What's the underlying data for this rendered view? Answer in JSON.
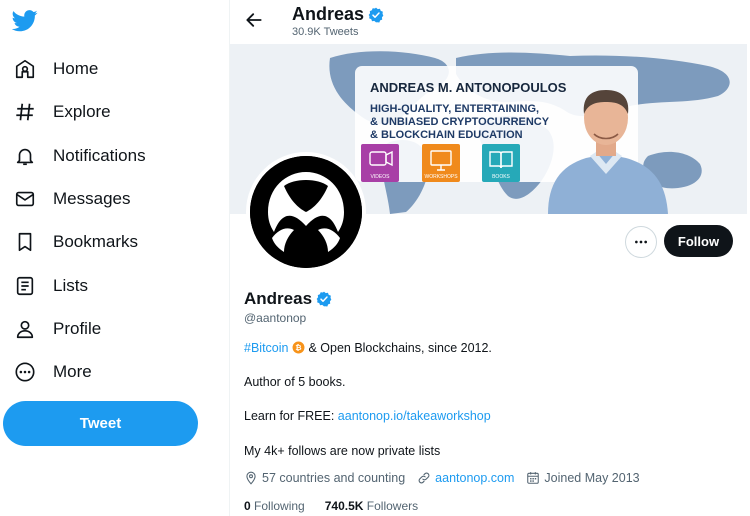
{
  "sidebar": {
    "items": [
      {
        "label": "Home",
        "icon": "home-icon"
      },
      {
        "label": "Explore",
        "icon": "hashtag-icon"
      },
      {
        "label": "Notifications",
        "icon": "bell-icon"
      },
      {
        "label": "Messages",
        "icon": "envelope-icon"
      },
      {
        "label": "Bookmarks",
        "icon": "bookmark-icon"
      },
      {
        "label": "Lists",
        "icon": "list-icon"
      },
      {
        "label": "Profile",
        "icon": "person-icon"
      },
      {
        "label": "More",
        "icon": "more-circle-icon"
      }
    ],
    "tweet_label": "Tweet"
  },
  "header": {
    "name": "Andreas",
    "tweet_count": "30.9K Tweets"
  },
  "banner": {
    "title": "ANDREAS M. ANTONOPOULOS",
    "tagline1": "HIGH-QUALITY, ENTERTAINING,",
    "tagline2": "& UNBIASED CRYPTOCURRENCY",
    "tagline3": "& BLOCKCHAIN EDUCATION",
    "tiles": [
      "VIDEOS",
      "WORKSHOPS",
      "BOOKS"
    ]
  },
  "profile": {
    "follow_label": "Follow",
    "name": "Andreas",
    "handle": "@aantonop",
    "bio_hashtag": "#Bitcoin",
    "bio_line1_rest": " & Open Blockchains, since 2012.",
    "bio_line2": "Author of 5 books.",
    "bio_line3_prefix": "Learn for FREE: ",
    "bio_line3_link": "aantonop.io/takeaworkshop",
    "bio_line4": "My 4k+ follows are now private lists",
    "location": "57 countries and counting",
    "website": "aantonop.com",
    "joined": "Joined May 2013",
    "following_count": "0",
    "following_label": "Following",
    "followers_count": "740.5K",
    "followers_label": "Followers"
  },
  "colors": {
    "accent": "#1d9bf0",
    "bitcoin": "#f7931a",
    "text": "#0f1419",
    "muted": "#536471"
  }
}
